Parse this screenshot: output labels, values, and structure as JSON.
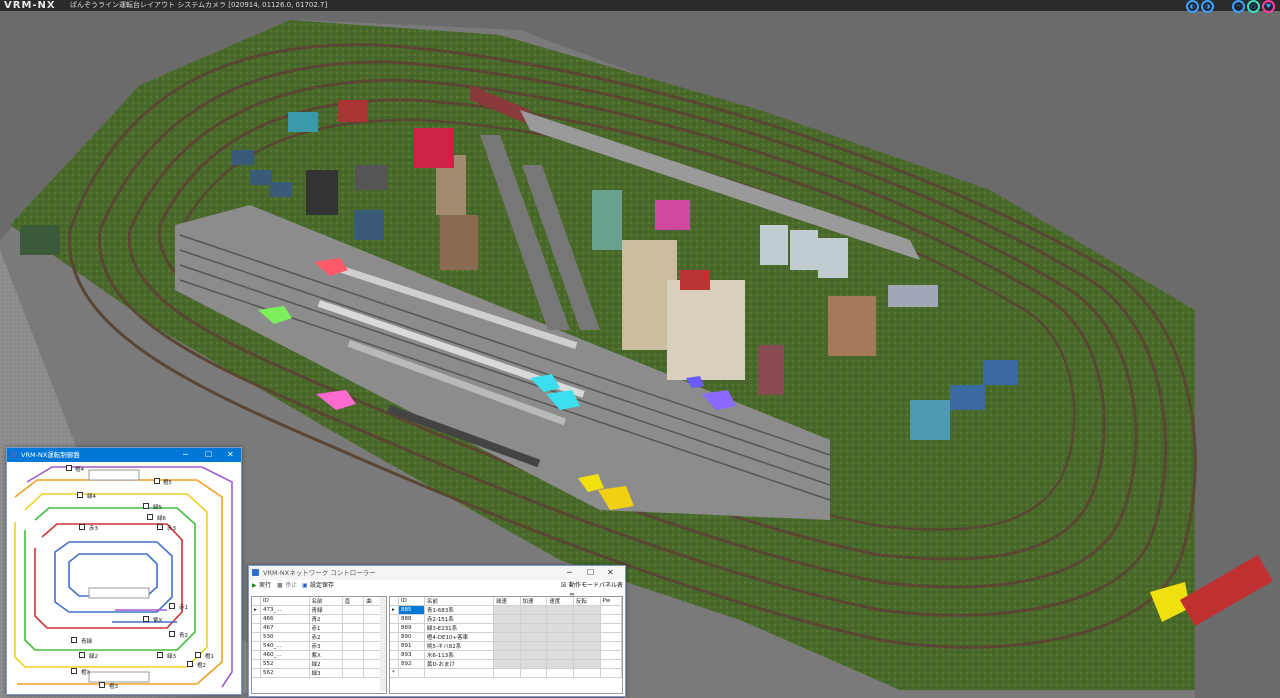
{
  "app": {
    "logo": "VRM-NX",
    "caption": "ぱんぞうライン運転台レイアウト システムカメラ [020914, 01126.0, 01702.7]"
  },
  "colors": {
    "background": "#6b6b6b",
    "grass": "#4b6b2c",
    "accent": "#0078d7"
  },
  "topbar_icons": [
    "camera-left-icon",
    "camera-right-icon",
    "minimize-icon",
    "restore-icon",
    "close-icon"
  ],
  "control_panel": {
    "title": "VRM-NX運転制御盤",
    "min": "─",
    "max": "☐",
    "close": "✕",
    "labels": {
      "top4": "橙4",
      "yel5": "橙5",
      "grn4": "緑4",
      "grn5": "緑5",
      "grn6": "緑6",
      "red3a": "赤3",
      "red3b": "赤3",
      "red1": "赤1",
      "purpleX": "紫X",
      "blue2": "青2",
      "blue1": "青緑",
      "grn2": "緑2",
      "grn3": "緑3",
      "yel1": "橙1",
      "yel2": "橙2",
      "orX": "橙X",
      "or3": "橙3"
    }
  },
  "network_controller": {
    "title": "VRM-NXネットワーク コントローラー",
    "run": "実行",
    "stop": "停止",
    "save": "設定保存",
    "mode": "動作モードパネル表示",
    "min": "─",
    "max": "☐",
    "close": "✕",
    "left_headers": [
      "ID",
      "名前",
      "直",
      "曲"
    ],
    "left_rows": [
      {
        "id": "473_...",
        "name": "青緑"
      },
      {
        "id": "466",
        "name": "青2"
      },
      {
        "id": "467",
        "name": "赤1"
      },
      {
        "id": "530",
        "name": "赤2"
      },
      {
        "id": "540_...",
        "name": "赤3"
      },
      {
        "id": "460_...",
        "name": "紫X"
      },
      {
        "id": "552",
        "name": "緑2"
      },
      {
        "id": "562",
        "name": "緑3"
      }
    ],
    "right_headers": [
      "ID",
      "名前",
      "減速",
      "加速",
      "速度",
      "反転",
      "Pw"
    ],
    "right_rows": [
      {
        "id": "885",
        "name": "青1-683系"
      },
      {
        "id": "888",
        "name": "赤2-151系"
      },
      {
        "id": "889",
        "name": "緑3-E231系"
      },
      {
        "id": "890",
        "name": "橙4-DE10+客車"
      },
      {
        "id": "891",
        "name": "桃5-キハ82系"
      },
      {
        "id": "893",
        "name": "水6-113系"
      },
      {
        "id": "892",
        "name": "黄D-おまけ"
      }
    ]
  }
}
